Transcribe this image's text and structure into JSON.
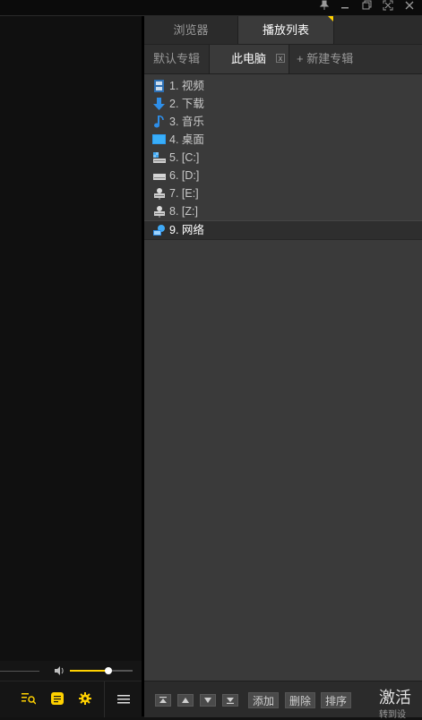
{
  "window": {
    "controls": [
      "pin-icon",
      "minimize-icon",
      "restore-icon",
      "fullscreen-icon",
      "close-icon"
    ]
  },
  "tabs": [
    {
      "label": "浏览器"
    },
    {
      "label": "播放列表"
    }
  ],
  "subtabs": {
    "default": "默认专辑",
    "pc": "此电脑",
    "close": "x",
    "new": "+ 新建专辑"
  },
  "items": [
    {
      "label": "1. 视频",
      "icon": "video-icon"
    },
    {
      "label": "2. 下载",
      "icon": "download-icon"
    },
    {
      "label": "3. 音乐",
      "icon": "music-icon"
    },
    {
      "label": "4. 桌面",
      "icon": "desktop-icon"
    },
    {
      "label": "5. [C:]",
      "icon": "system-drive-icon"
    },
    {
      "label": "6. [D:]",
      "icon": "drive-icon"
    },
    {
      "label": "7. [E:]",
      "icon": "network-drive-icon"
    },
    {
      "label": "8. [Z:]",
      "icon": "network-drive-icon"
    },
    {
      "label": "9. 网络",
      "icon": "network-icon"
    }
  ],
  "selected_index": 8,
  "bottom": {
    "add": "添加",
    "delete": "删除",
    "sort": "排序",
    "activate": "激活",
    "activate_hint": "转到设"
  },
  "volume": {
    "level": 0.62
  },
  "accent_color": "#ffd100"
}
